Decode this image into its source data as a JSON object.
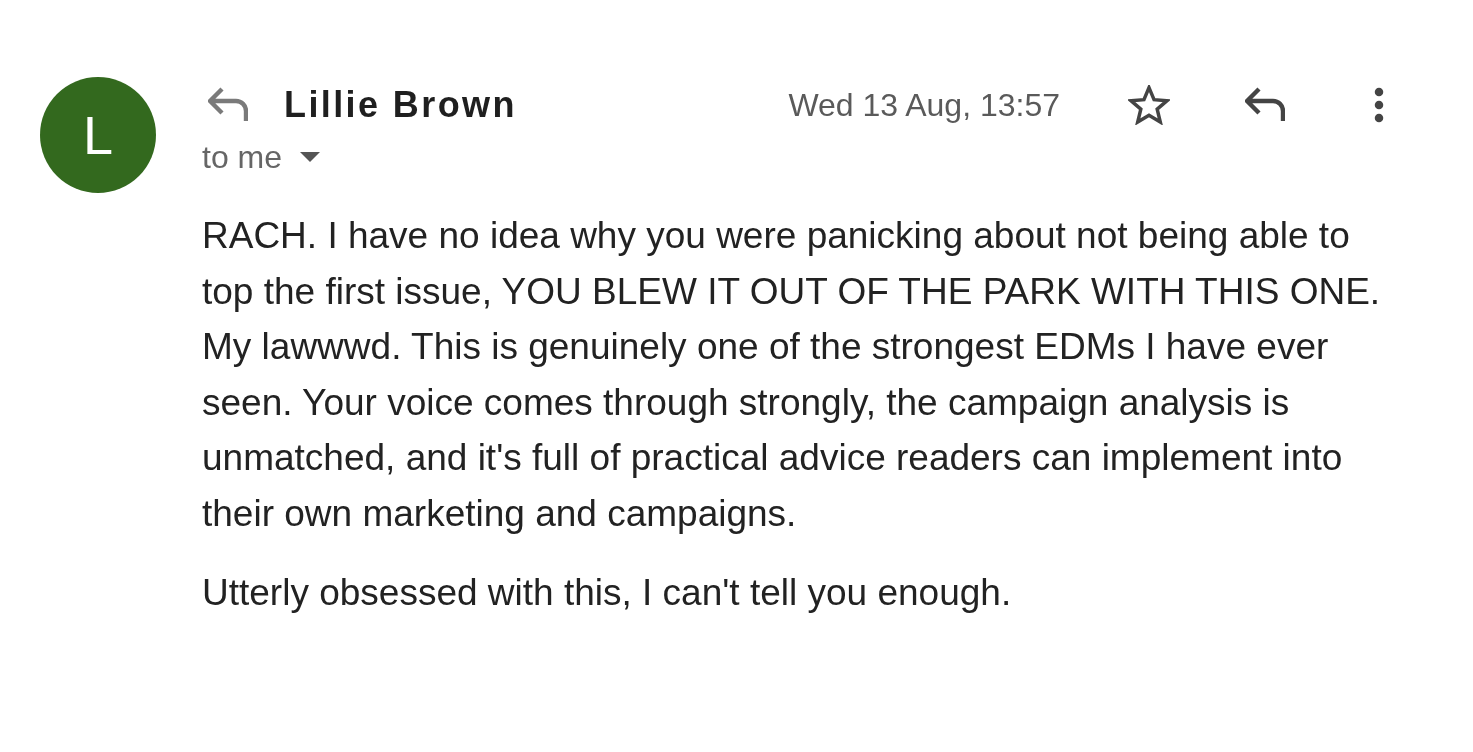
{
  "sender": {
    "avatar_letter": "L",
    "name": "Lillie Brown"
  },
  "recipient": "to me",
  "date": "Wed 13 Aug, 13:57",
  "starred": false,
  "body": [
    "RACH. I have no idea why you were panicking about not being able to top the first issue, YOU BLEW IT OUT OF THE PARK WITH THIS ONE. My lawwwd. This is genuinely one of the strongest EDMs I have ever seen. Your voice comes through strongly, the campaign analysis is unmatched, and it's full of practical advice readers can implement into their own marketing and campaigns.",
    "Utterly obsessed with this, I can't tell you enough."
  ]
}
